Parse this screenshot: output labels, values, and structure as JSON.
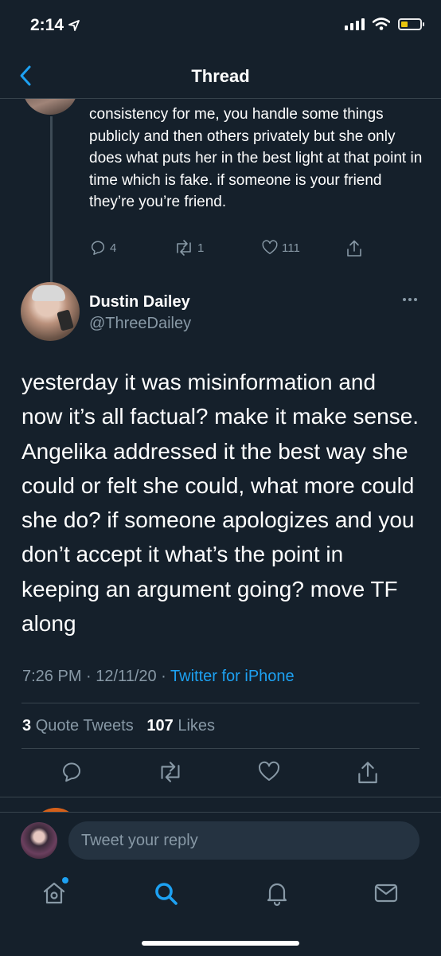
{
  "status_bar": {
    "time": "2:14"
  },
  "header": {
    "title": "Thread"
  },
  "previous_tweet": {
    "text": "consistency for me, you handle some things publicly and then others privately but she only does what puts her in the best light at that point in time which is fake. if someone is your friend they’re you’re friend.",
    "replies": "4",
    "retweets": "1",
    "likes": "111"
  },
  "tweet": {
    "author_name": "Dustin Dailey",
    "author_handle": "@ThreeDailey",
    "body": "yesterday it was misinformation and now it’s all factual? make it make sense. Angelika addressed it the best way she could or felt she could, what more could she do? if someone apologizes and you don’t accept it what’s the point in keeping an argument going? move TF along",
    "timestamp": "7:26 PM · 12/11/20 · ",
    "source": "Twitter for iPhone",
    "quote_count": "3",
    "quote_label": "Quote Tweets",
    "like_count": "107",
    "like_label": "Likes"
  },
  "reply": {
    "placeholder": "Tweet your reply"
  },
  "tabs": [
    "home-icon",
    "search-icon",
    "notifications-icon",
    "messages-icon"
  ],
  "colors": {
    "background": "#15202b",
    "accent": "#1da1f2",
    "muted": "#8899a6",
    "border": "#38444d"
  }
}
